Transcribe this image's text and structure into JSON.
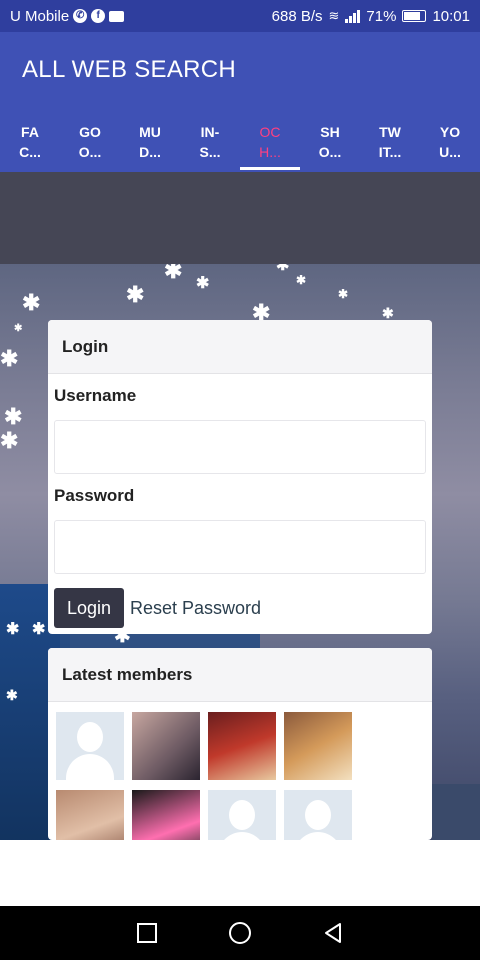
{
  "status_bar": {
    "carrier": "U Mobile",
    "speed": "688 B/s",
    "battery": "71%",
    "battery_level": 0.71,
    "time": "10:01"
  },
  "app_bar": {
    "title": "ALL WEB SEARCH",
    "tabs": [
      {
        "line1": "FA",
        "line2": "C..."
      },
      {
        "line1": "GO",
        "line2": "O..."
      },
      {
        "line1": "MU",
        "line2": "D..."
      },
      {
        "line1": "IN-",
        "line2": "S..."
      },
      {
        "line1": "OC",
        "line2": "H..."
      },
      {
        "line1": "SH",
        "line2": "O..."
      },
      {
        "line1": "TW",
        "line2": "IT..."
      },
      {
        "line1": "YO",
        "line2": "U..."
      }
    ],
    "active_tab_index": 4,
    "active_tab_color": "#ff4081",
    "accent_color": "#3f51b5"
  },
  "login": {
    "title": "Login",
    "username_label": "Username",
    "username_value": "",
    "password_label": "Password",
    "password_value": "",
    "login_button": "Login",
    "reset_link": "Reset Password"
  },
  "members": {
    "title": "Latest members",
    "avatars": [
      "default-avatar",
      "member-photo",
      "member-photo",
      "member-photo",
      "member-photo",
      "member-photo",
      "default-avatar",
      "default-avatar"
    ]
  },
  "nav_bar": {
    "icons": [
      "recent-apps-icon",
      "home-icon",
      "back-icon"
    ]
  }
}
